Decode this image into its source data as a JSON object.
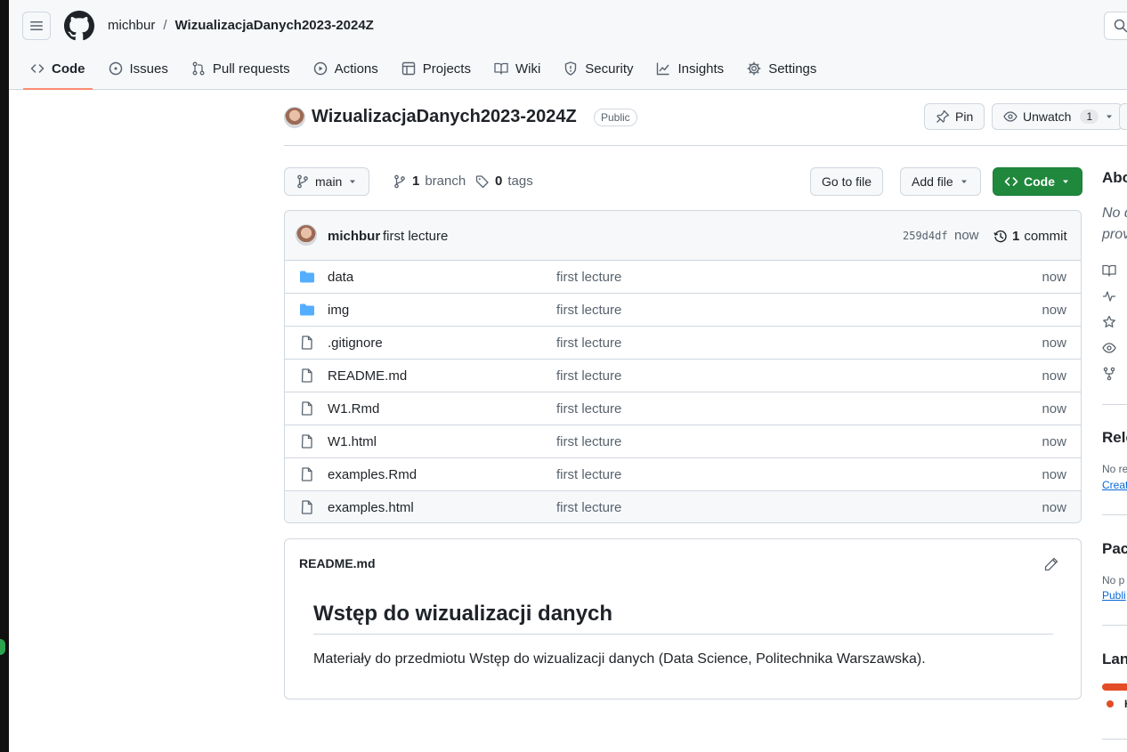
{
  "header": {
    "owner": "michbur",
    "separator": "/",
    "repo": "WizualizacjaDanych2023-2024Z"
  },
  "nav": {
    "tabs": [
      {
        "label": "Code",
        "icon": "code-icon"
      },
      {
        "label": "Issues",
        "icon": "issue-icon"
      },
      {
        "label": "Pull requests",
        "icon": "pull-request-icon"
      },
      {
        "label": "Actions",
        "icon": "play-icon"
      },
      {
        "label": "Projects",
        "icon": "table-icon"
      },
      {
        "label": "Wiki",
        "icon": "book-icon"
      },
      {
        "label": "Security",
        "icon": "shield-icon"
      },
      {
        "label": "Insights",
        "icon": "graph-icon"
      },
      {
        "label": "Settings",
        "icon": "gear-icon"
      }
    ]
  },
  "repo_head": {
    "title": "WizualizacjaDanych2023-2024Z",
    "visibility": "Public",
    "pin_label": "Pin",
    "watch_label": "Unwatch",
    "watch_count": "1"
  },
  "toolbar": {
    "branch": "main",
    "branch_count": "1",
    "branch_label": "branch",
    "tag_count": "0",
    "tag_label": "tags",
    "goto_label": "Go to file",
    "addfile_label": "Add file",
    "code_label": "Code"
  },
  "commit": {
    "author": "michbur",
    "message": "first lecture",
    "hash": "259d4df",
    "time": "now",
    "count": "1",
    "count_label": "commit"
  },
  "files": [
    {
      "name": "data",
      "type": "folder",
      "message": "first lecture",
      "time": "now"
    },
    {
      "name": "img",
      "type": "folder",
      "message": "first lecture",
      "time": "now"
    },
    {
      "name": ".gitignore",
      "type": "file",
      "message": "first lecture",
      "time": "now"
    },
    {
      "name": "README.md",
      "type": "file",
      "message": "first lecture",
      "time": "now"
    },
    {
      "name": "W1.Rmd",
      "type": "file",
      "message": "first lecture",
      "time": "now"
    },
    {
      "name": "W1.html",
      "type": "file",
      "message": "first lecture",
      "time": "now"
    },
    {
      "name": "examples.Rmd",
      "type": "file",
      "message": "first lecture",
      "time": "now"
    },
    {
      "name": "examples.html",
      "type": "file",
      "message": "first lecture",
      "time": "now"
    }
  ],
  "readme": {
    "title": "README.md",
    "heading": "Wstęp do wizualizacji danych",
    "body": "Materiały do przedmiotu Wstęp do wizualizacji danych (Data Science, Politechnika Warszawska)."
  },
  "sidebar": {
    "about": "Abo",
    "desc_1": "No d",
    "desc_2": "prov",
    "releases": "Rele",
    "releases_none": "No re",
    "releases_link": "Creat",
    "packages": "Pac",
    "packages_none": "No p",
    "packages_link": "Publi",
    "languages": "Lan",
    "language_dot_label": "H"
  },
  "colors": {
    "accent_underline": "#fd8c73",
    "code_button": "#1f883d",
    "folder": "#54aeff",
    "language_bar": "#e34c26",
    "link": "#0969da"
  }
}
